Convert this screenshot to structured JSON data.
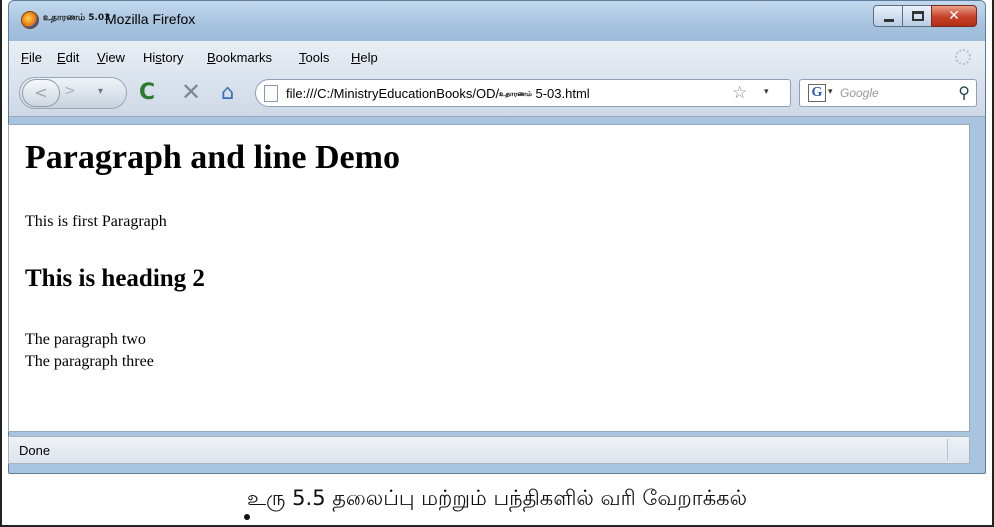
{
  "window": {
    "title_prefix": "உதாரணம் 5.03",
    "title": "Mozilla Firefox"
  },
  "menubar": {
    "items": [
      "File",
      "Edit",
      "View",
      "History",
      "Bookmarks",
      "Tools",
      "Help"
    ],
    "mnemonics": [
      "F",
      "E",
      "V",
      "s",
      "B",
      "T",
      "H"
    ]
  },
  "toolbar": {
    "back_icon": "back-arrow-icon",
    "forward_icon": "forward-arrow-icon",
    "reload_icon": "reload-icon",
    "stop_icon": "stop-icon",
    "home_icon": "home-icon"
  },
  "address": {
    "url_prefix": "file:///C:/MinistryEducationBooks/OD/",
    "url_tamil": "உதாரணம்",
    "url_suffix": " 5-03.html"
  },
  "search": {
    "engine_letter": "G",
    "placeholder": "Google"
  },
  "page": {
    "heading1": "Paragraph and line Demo",
    "paragraph1": "This is first Paragraph",
    "heading2": "This is heading 2",
    "paragraph2_line1": "The paragraph two",
    "paragraph2_line2": "The paragraph three"
  },
  "status": {
    "text": "Done"
  },
  "caption": {
    "text": "உரு 5.5 தலைப்பு மற்றும் பந்திகளில் வரி வேறாக்கல்"
  }
}
